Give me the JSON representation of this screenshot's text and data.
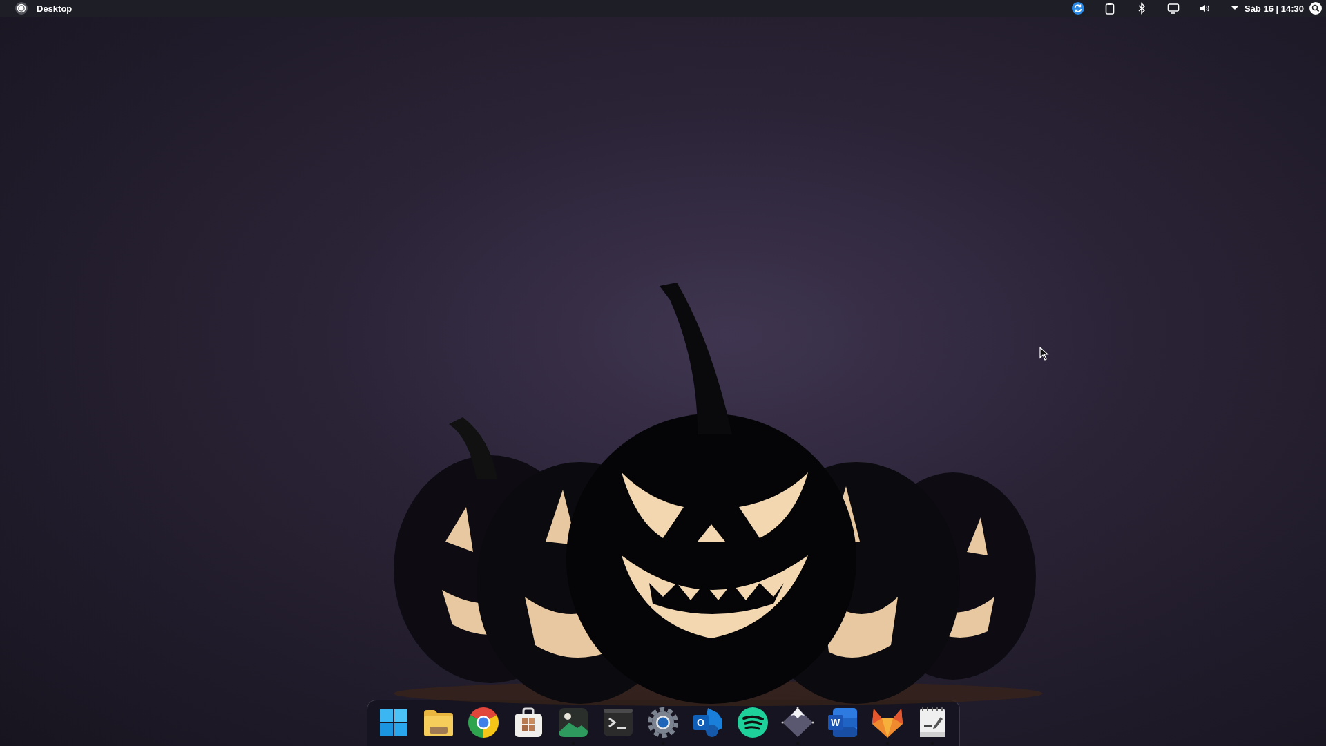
{
  "top_bar": {
    "title": "Desktop",
    "clock": "Sáb 16 | 14:30"
  },
  "dock": {
    "items": [
      {
        "kind": "start",
        "running": false
      },
      {
        "kind": "files",
        "running": false
      },
      {
        "kind": "browser",
        "running": false
      },
      {
        "kind": "store",
        "running": false
      },
      {
        "kind": "images",
        "running": true
      },
      {
        "kind": "terminal",
        "running": false
      },
      {
        "kind": "settings",
        "running": true
      },
      {
        "kind": "mail",
        "glyph": "O",
        "running": false
      },
      {
        "kind": "music",
        "running": false
      },
      {
        "kind": "vector",
        "running": true
      },
      {
        "kind": "word",
        "glyph": "W",
        "running": false
      },
      {
        "kind": "fox",
        "running": true
      },
      {
        "kind": "notes",
        "running": true
      }
    ]
  }
}
